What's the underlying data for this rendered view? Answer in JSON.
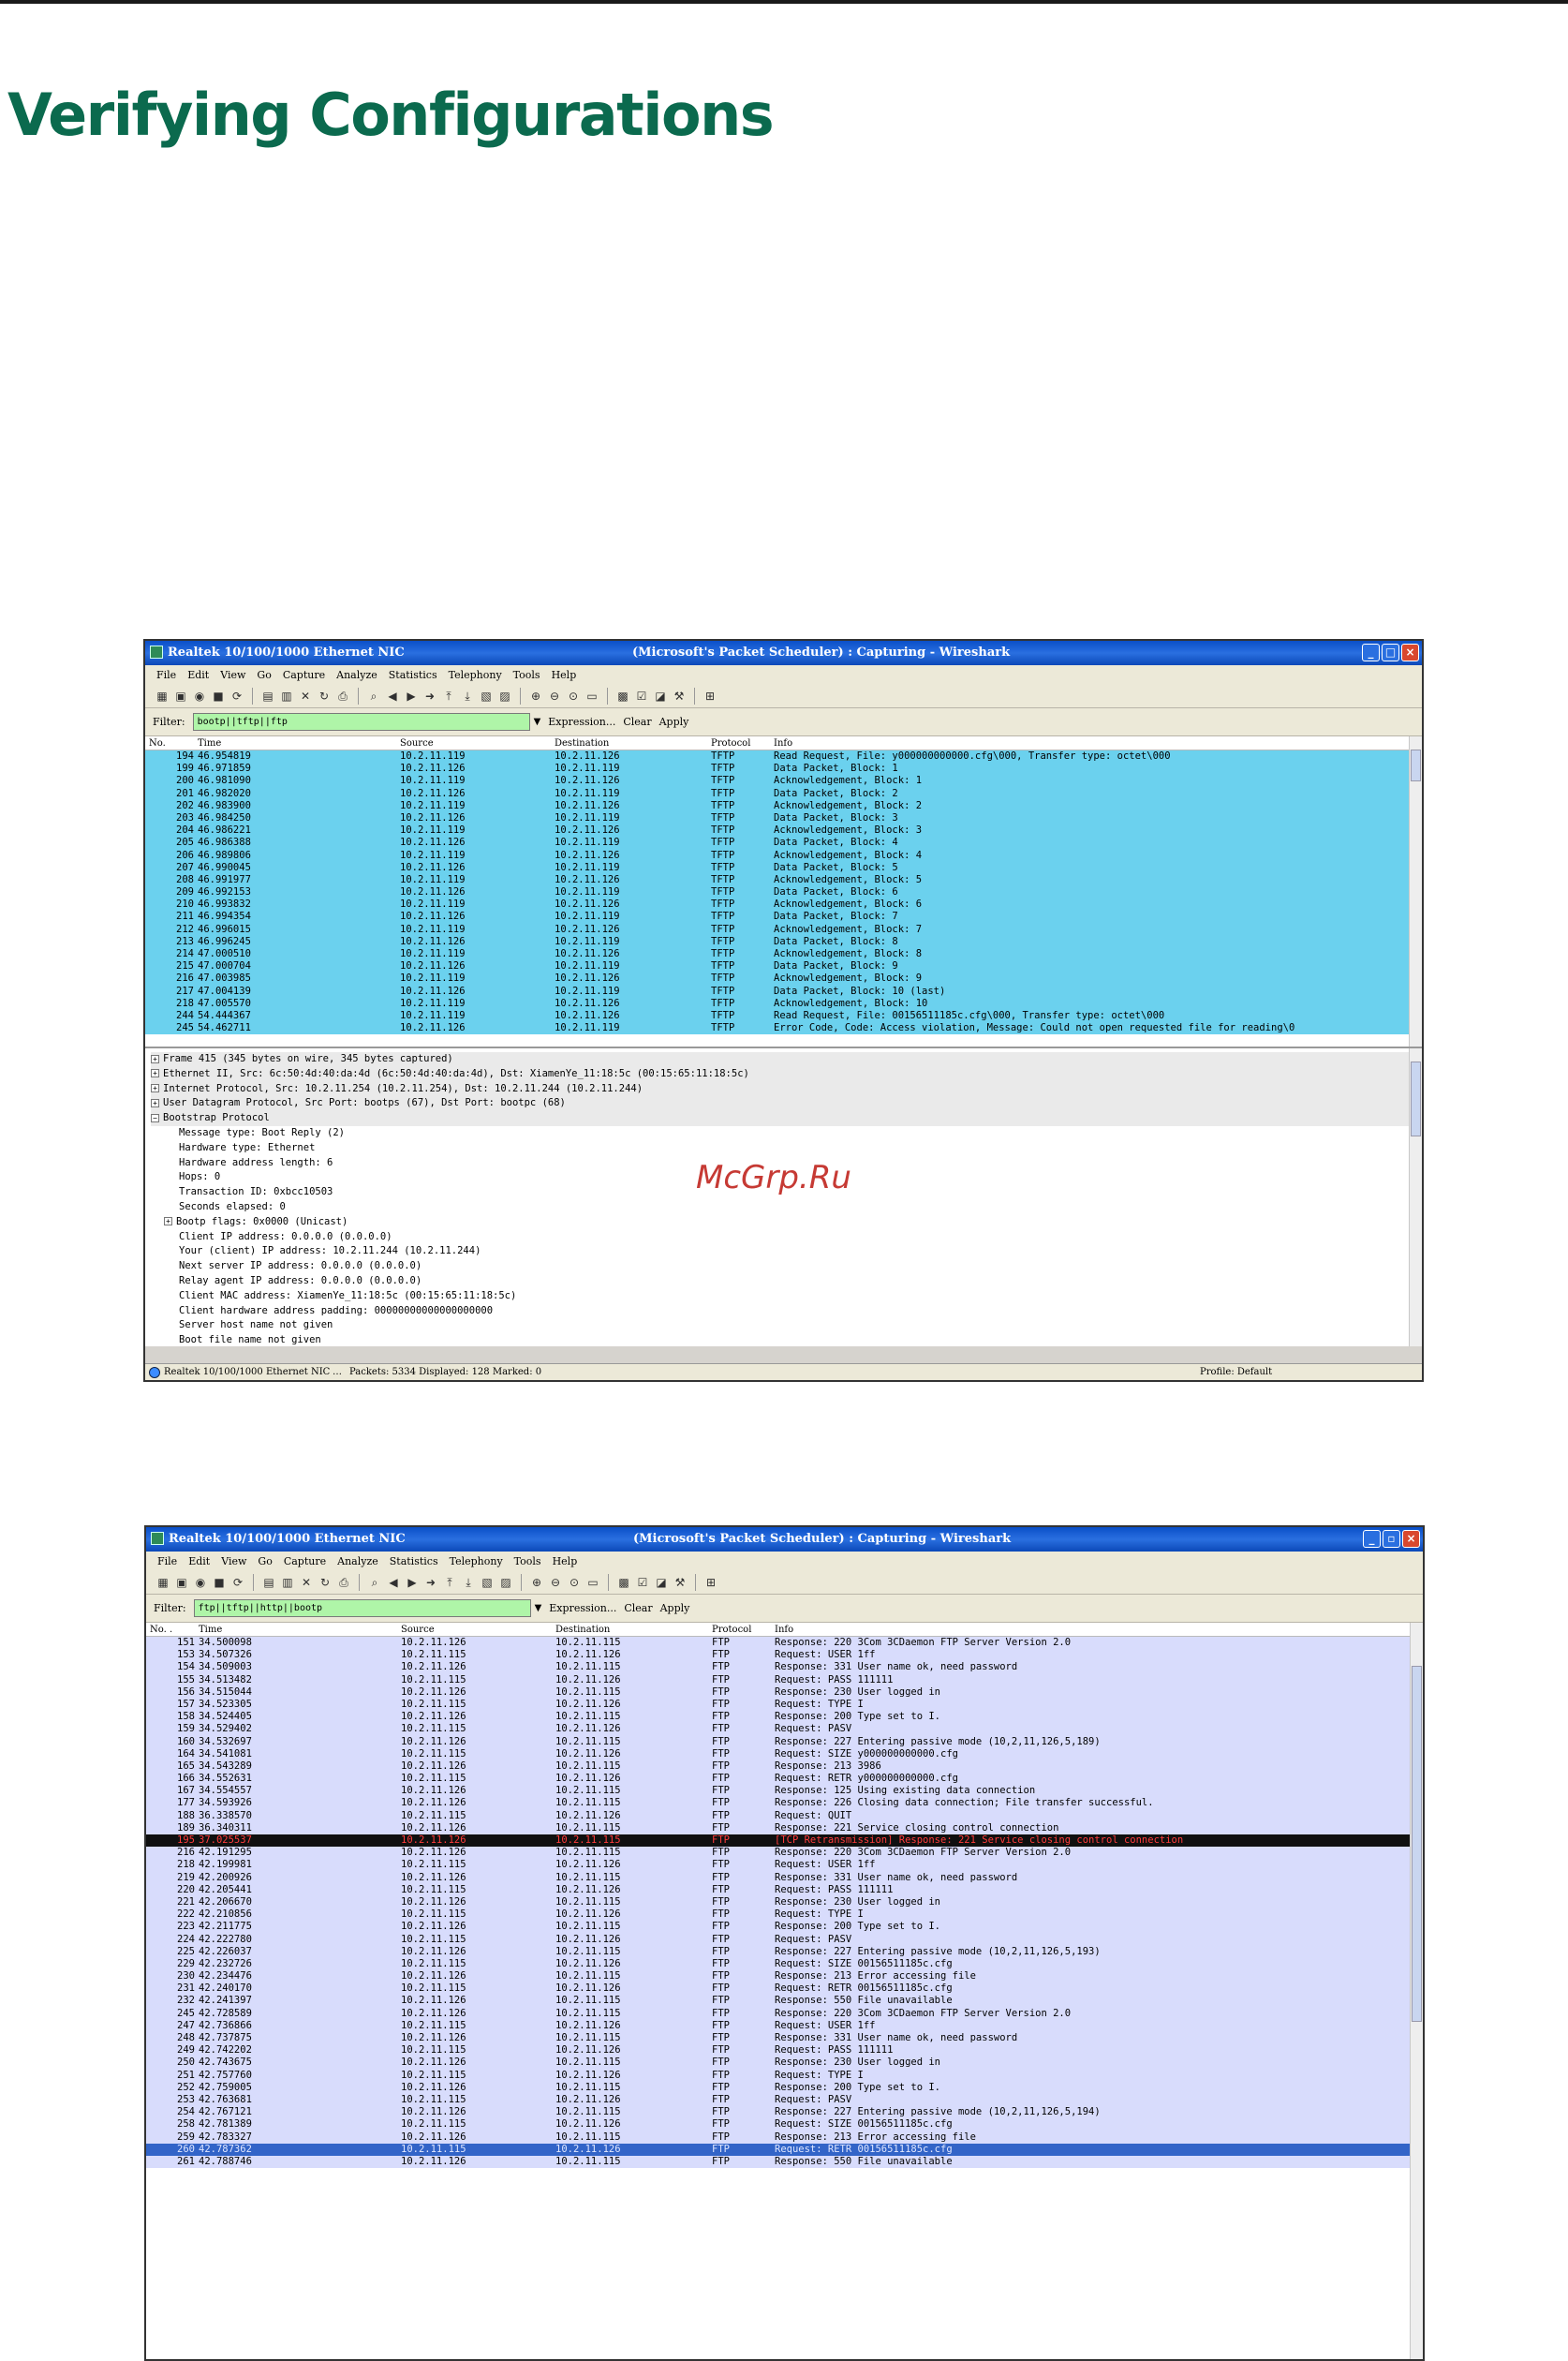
{
  "page": {
    "title": "Verifying Configurations",
    "watermark": "McGrp.Ru"
  },
  "menu_items": [
    "File",
    "Edit",
    "View",
    "Go",
    "Capture",
    "Analyze",
    "Statistics",
    "Telephony",
    "Tools",
    "Help"
  ],
  "toolbar_icons": [
    "capture-interfaces-icon",
    "capture-options-icon",
    "capture-start-icon",
    "capture-stop-icon",
    "capture-restart-icon",
    "open-icon",
    "save-icon",
    "close-file-icon",
    "reload-icon",
    "print-icon",
    "find-icon",
    "back-icon",
    "forward-icon",
    "go-to-icon",
    "first-icon",
    "last-icon",
    "colorize-icon",
    "autoscroll-icon",
    "zoom-in-icon",
    "zoom-out-icon",
    "zoom-normal-icon",
    "resize-columns-icon",
    "capture-filters-icon",
    "display-filters-icon",
    "coloring-rules-icon",
    "preferences-icon",
    "help-icon"
  ],
  "windows": [
    {
      "title_left": "Realtek 10/100/1000 Ethernet NIC",
      "title_center": "(Microsoft's Packet Scheduler) : Capturing - Wireshark",
      "filter_label": "Filter:",
      "filter_value": "bootp||tftp||ftp",
      "filter_actions": [
        "Expression...",
        "Clear",
        "Apply"
      ],
      "columns": [
        "No.",
        "Time",
        "Source",
        "Destination",
        "Protocol",
        "Info"
      ],
      "rows": [
        [
          "194",
          "46.954819",
          "10.2.11.119",
          "10.2.11.126",
          "TFTP",
          "Read Request, File: y000000000000.cfg\\000, Transfer type: octet\\000"
        ],
        [
          "199",
          "46.971859",
          "10.2.11.126",
          "10.2.11.119",
          "TFTP",
          "Data Packet, Block: 1"
        ],
        [
          "200",
          "46.981090",
          "10.2.11.119",
          "10.2.11.126",
          "TFTP",
          "Acknowledgement, Block: 1"
        ],
        [
          "201",
          "46.982020",
          "10.2.11.126",
          "10.2.11.119",
          "TFTP",
          "Data Packet, Block: 2"
        ],
        [
          "202",
          "46.983900",
          "10.2.11.119",
          "10.2.11.126",
          "TFTP",
          "Acknowledgement, Block: 2"
        ],
        [
          "203",
          "46.984250",
          "10.2.11.126",
          "10.2.11.119",
          "TFTP",
          "Data Packet, Block: 3"
        ],
        [
          "204",
          "46.986221",
          "10.2.11.119",
          "10.2.11.126",
          "TFTP",
          "Acknowledgement, Block: 3"
        ],
        [
          "205",
          "46.986388",
          "10.2.11.126",
          "10.2.11.119",
          "TFTP",
          "Data Packet, Block: 4"
        ],
        [
          "206",
          "46.989806",
          "10.2.11.119",
          "10.2.11.126",
          "TFTP",
          "Acknowledgement, Block: 4"
        ],
        [
          "207",
          "46.990045",
          "10.2.11.126",
          "10.2.11.119",
          "TFTP",
          "Data Packet, Block: 5"
        ],
        [
          "208",
          "46.991977",
          "10.2.11.119",
          "10.2.11.126",
          "TFTP",
          "Acknowledgement, Block: 5"
        ],
        [
          "209",
          "46.992153",
          "10.2.11.126",
          "10.2.11.119",
          "TFTP",
          "Data Packet, Block: 6"
        ],
        [
          "210",
          "46.993832",
          "10.2.11.119",
          "10.2.11.126",
          "TFTP",
          "Acknowledgement, Block: 6"
        ],
        [
          "211",
          "46.994354",
          "10.2.11.126",
          "10.2.11.119",
          "TFTP",
          "Data Packet, Block: 7"
        ],
        [
          "212",
          "46.996015",
          "10.2.11.119",
          "10.2.11.126",
          "TFTP",
          "Acknowledgement, Block: 7"
        ],
        [
          "213",
          "46.996245",
          "10.2.11.126",
          "10.2.11.119",
          "TFTP",
          "Data Packet, Block: 8"
        ],
        [
          "214",
          "47.000510",
          "10.2.11.119",
          "10.2.11.126",
          "TFTP",
          "Acknowledgement, Block: 8"
        ],
        [
          "215",
          "47.000704",
          "10.2.11.126",
          "10.2.11.119",
          "TFTP",
          "Data Packet, Block: 9"
        ],
        [
          "216",
          "47.003985",
          "10.2.11.119",
          "10.2.11.126",
          "TFTP",
          "Acknowledgement, Block: 9"
        ],
        [
          "217",
          "47.004139",
          "10.2.11.126",
          "10.2.11.119",
          "TFTP",
          "Data Packet, Block: 10 (last)"
        ],
        [
          "218",
          "47.005570",
          "10.2.11.119",
          "10.2.11.126",
          "TFTP",
          "Acknowledgement, Block: 10"
        ],
        [
          "244",
          "54.444367",
          "10.2.11.119",
          "10.2.11.126",
          "TFTP",
          "Read Request, File: 00156511185c.cfg\\000, Transfer type: octet\\000"
        ],
        [
          "245",
          "54.462711",
          "10.2.11.126",
          "10.2.11.119",
          "TFTP",
          "Error Code, Code: Access violation, Message: Could not open requested file for reading\\0"
        ]
      ],
      "tree": [
        {
          "text": "Frame 415 (345 bytes on wire, 345 bytes captured)",
          "level": 0,
          "exp": "+"
        },
        {
          "text": "Ethernet II, Src: 6c:50:4d:40:da:4d (6c:50:4d:40:da:4d), Dst: XiamenYe_11:18:5c (00:15:65:11:18:5c)",
          "level": 0,
          "exp": "+"
        },
        {
          "text": "Internet Protocol, Src: 10.2.11.254 (10.2.11.254), Dst: 10.2.11.244 (10.2.11.244)",
          "level": 0,
          "exp": "+"
        },
        {
          "text": "User Datagram Protocol, Src Port: bootps (67), Dst Port: bootpc (68)",
          "level": 0,
          "exp": "+"
        },
        {
          "text": "Bootstrap Protocol",
          "level": 0,
          "exp": "-"
        },
        {
          "text": "Message type: Boot Reply (2)",
          "level": 1
        },
        {
          "text": "Hardware type: Ethernet",
          "level": 1
        },
        {
          "text": "Hardware address length: 6",
          "level": 1
        },
        {
          "text": "Hops: 0",
          "level": 1
        },
        {
          "text": "Transaction ID: 0xbcc10503",
          "level": 1
        },
        {
          "text": "Seconds elapsed: 0",
          "level": 1
        },
        {
          "text": "Bootp flags: 0x0000 (Unicast)",
          "level": 2,
          "exp": "+"
        },
        {
          "text": "Client IP address: 0.0.0.0 (0.0.0.0)",
          "level": 1
        },
        {
          "text": "Your (client) IP address: 10.2.11.244 (10.2.11.244)",
          "level": 1
        },
        {
          "text": "Next server IP address: 0.0.0.0 (0.0.0.0)",
          "level": 1
        },
        {
          "text": "Relay agent IP address: 0.0.0.0 (0.0.0.0)",
          "level": 1
        },
        {
          "text": "Client MAC address: XiamenYe_11:18:5c (00:15:65:11:18:5c)",
          "level": 1
        },
        {
          "text": "Client hardware address padding: 00000000000000000000",
          "level": 1
        },
        {
          "text": "Server host name not given",
          "level": 1
        },
        {
          "text": "Boot file name not given",
          "level": 1
        }
      ],
      "status": {
        "interface": "Realtek 10/100/1000 Ethernet NIC",
        "counts": "Packets: 5334 Displayed: 128 Marked: 0",
        "profile": "Profile: Default"
      }
    },
    {
      "title_left": "Realtek 10/100/1000 Ethernet NIC",
      "title_center": "(Microsoft's Packet Scheduler) : Capturing - Wireshark",
      "filter_label": "Filter:",
      "filter_value": "ftp||tftp||http||bootp",
      "filter_actions": [
        "Expression...",
        "Clear",
        "Apply"
      ],
      "columns": [
        "No. .",
        "Time",
        "Source",
        "Destination",
        "Protocol",
        "Info"
      ],
      "rows": [
        [
          "151",
          "34.500098",
          "10.2.11.126",
          "10.2.11.115",
          "FTP",
          "Response: 220 3Com 3CDaemon FTP Server Version 2.0"
        ],
        [
          "153",
          "34.507326",
          "10.2.11.115",
          "10.2.11.126",
          "FTP",
          "Request: USER 1ff"
        ],
        [
          "154",
          "34.509003",
          "10.2.11.126",
          "10.2.11.115",
          "FTP",
          "Response: 331 User name ok, need password"
        ],
        [
          "155",
          "34.513482",
          "10.2.11.115",
          "10.2.11.126",
          "FTP",
          "Request: PASS 111111"
        ],
        [
          "156",
          "34.515044",
          "10.2.11.126",
          "10.2.11.115",
          "FTP",
          "Response: 230 User logged in"
        ],
        [
          "157",
          "34.523305",
          "10.2.11.115",
          "10.2.11.126",
          "FTP",
          "Request: TYPE I"
        ],
        [
          "158",
          "34.524405",
          "10.2.11.126",
          "10.2.11.115",
          "FTP",
          "Response: 200 Type set to I."
        ],
        [
          "159",
          "34.529402",
          "10.2.11.115",
          "10.2.11.126",
          "FTP",
          "Request: PASV"
        ],
        [
          "160",
          "34.532697",
          "10.2.11.126",
          "10.2.11.115",
          "FTP",
          "Response: 227 Entering passive mode (10,2,11,126,5,189)"
        ],
        [
          "164",
          "34.541081",
          "10.2.11.115",
          "10.2.11.126",
          "FTP",
          "Request: SIZE y000000000000.cfg"
        ],
        [
          "165",
          "34.543289",
          "10.2.11.126",
          "10.2.11.115",
          "FTP",
          "Response: 213 3986"
        ],
        [
          "166",
          "34.552631",
          "10.2.11.115",
          "10.2.11.126",
          "FTP",
          "Request: RETR y000000000000.cfg"
        ],
        [
          "167",
          "34.554557",
          "10.2.11.126",
          "10.2.11.115",
          "FTP",
          "Response: 125 Using existing data connection"
        ],
        [
          "177",
          "34.593926",
          "10.2.11.126",
          "10.2.11.115",
          "FTP",
          "Response: 226 Closing data connection; File transfer successful."
        ],
        [
          "188",
          "36.338570",
          "10.2.11.115",
          "10.2.11.126",
          "FTP",
          "Request: QUIT"
        ],
        [
          "189",
          "36.340311",
          "10.2.11.126",
          "10.2.11.115",
          "FTP",
          "Response: 221 Service closing control connection"
        ],
        [
          "195",
          "37.025537",
          "10.2.11.126",
          "10.2.11.115",
          "FTP",
          "[TCP Retransmission] Response: 221 Service closing control connection"
        ],
        [
          "216",
          "42.191295",
          "10.2.11.126",
          "10.2.11.115",
          "FTP",
          "Response: 220 3Com 3CDaemon FTP Server Version 2.0"
        ],
        [
          "218",
          "42.199981",
          "10.2.11.115",
          "10.2.11.126",
          "FTP",
          "Request: USER 1ff"
        ],
        [
          "219",
          "42.200926",
          "10.2.11.126",
          "10.2.11.115",
          "FTP",
          "Response: 331 User name ok, need password"
        ],
        [
          "220",
          "42.205441",
          "10.2.11.115",
          "10.2.11.126",
          "FTP",
          "Request: PASS 111111"
        ],
        [
          "221",
          "42.206670",
          "10.2.11.126",
          "10.2.11.115",
          "FTP",
          "Response: 230 User logged in"
        ],
        [
          "222",
          "42.210856",
          "10.2.11.115",
          "10.2.11.126",
          "FTP",
          "Request: TYPE I"
        ],
        [
          "223",
          "42.211775",
          "10.2.11.126",
          "10.2.11.115",
          "FTP",
          "Response: 200 Type set to I."
        ],
        [
          "224",
          "42.222780",
          "10.2.11.115",
          "10.2.11.126",
          "FTP",
          "Request: PASV"
        ],
        [
          "225",
          "42.226037",
          "10.2.11.126",
          "10.2.11.115",
          "FTP",
          "Response: 227 Entering passive mode (10,2,11,126,5,193)"
        ],
        [
          "229",
          "42.232726",
          "10.2.11.115",
          "10.2.11.126",
          "FTP",
          "Request: SIZE 00156511185c.cfg"
        ],
        [
          "230",
          "42.234476",
          "10.2.11.126",
          "10.2.11.115",
          "FTP",
          "Response: 213 Error accessing file"
        ],
        [
          "231",
          "42.240170",
          "10.2.11.115",
          "10.2.11.126",
          "FTP",
          "Request: RETR 00156511185c.cfg"
        ],
        [
          "232",
          "42.241397",
          "10.2.11.126",
          "10.2.11.115",
          "FTP",
          "Response: 550 File unavailable"
        ],
        [
          "245",
          "42.728589",
          "10.2.11.126",
          "10.2.11.115",
          "FTP",
          "Response: 220 3Com 3CDaemon FTP Server Version 2.0"
        ],
        [
          "247",
          "42.736866",
          "10.2.11.115",
          "10.2.11.126",
          "FTP",
          "Request: USER 1ff"
        ],
        [
          "248",
          "42.737875",
          "10.2.11.126",
          "10.2.11.115",
          "FTP",
          "Response: 331 User name ok, need password"
        ],
        [
          "249",
          "42.742202",
          "10.2.11.115",
          "10.2.11.126",
          "FTP",
          "Request: PASS 111111"
        ],
        [
          "250",
          "42.743675",
          "10.2.11.126",
          "10.2.11.115",
          "FTP",
          "Response: 230 User logged in"
        ],
        [
          "251",
          "42.757760",
          "10.2.11.115",
          "10.2.11.126",
          "FTP",
          "Request: TYPE I"
        ],
        [
          "252",
          "42.759005",
          "10.2.11.126",
          "10.2.11.115",
          "FTP",
          "Response: 200 Type set to I."
        ],
        [
          "253",
          "42.763681",
          "10.2.11.115",
          "10.2.11.126",
          "FTP",
          "Request: PASV"
        ],
        [
          "254",
          "42.767121",
          "10.2.11.126",
          "10.2.11.115",
          "FTP",
          "Response: 227 Entering passive mode (10,2,11,126,5,194)"
        ],
        [
          "258",
          "42.781389",
          "10.2.11.115",
          "10.2.11.126",
          "FTP",
          "Request: SIZE 00156511185c.cfg"
        ],
        [
          "259",
          "42.783327",
          "10.2.11.126",
          "10.2.11.115",
          "FTP",
          "Response: 213 Error accessing file"
        ],
        [
          "260",
          "42.787362",
          "10.2.11.115",
          "10.2.11.126",
          "FTP",
          "Request: RETR 00156511185c.cfg"
        ],
        [
          "261",
          "42.788746",
          "10.2.11.126",
          "10.2.11.115",
          "FTP",
          "Response: 550 File unavailable"
        ]
      ],
      "row_highlights": {
        "16": "sel-black",
        "41": "sel-blue"
      }
    }
  ]
}
